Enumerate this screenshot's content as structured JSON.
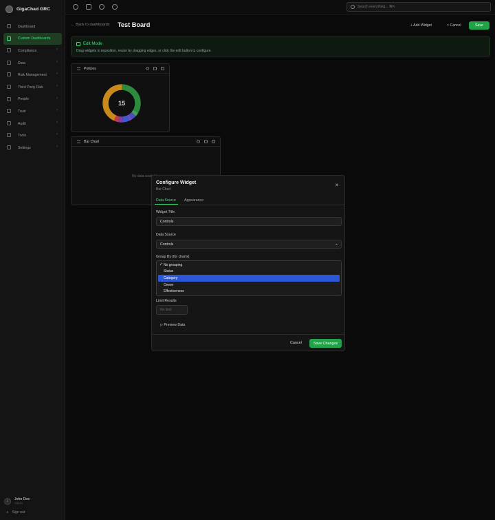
{
  "app": {
    "name": "GigaChad GRC"
  },
  "sidebar": {
    "items": [
      {
        "label": "Dashboard",
        "chevron": false,
        "active": false
      },
      {
        "label": "Custom Dashboards",
        "chevron": false,
        "active": true
      },
      {
        "label": "Compliance",
        "chevron": true,
        "active": false
      },
      {
        "label": "Data",
        "chevron": true,
        "active": false
      },
      {
        "label": "Risk Management",
        "chevron": true,
        "active": false
      },
      {
        "label": "Third Party Risk",
        "chevron": true,
        "active": false
      },
      {
        "label": "People",
        "chevron": true,
        "active": false
      },
      {
        "label": "Trust",
        "chevron": true,
        "active": false
      },
      {
        "label": "Audit",
        "chevron": true,
        "active": false
      },
      {
        "label": "Tools",
        "chevron": true,
        "active": false
      },
      {
        "label": "Settings",
        "chevron": true,
        "active": false
      }
    ],
    "user": {
      "initial": "J",
      "name": "John Doe",
      "role": "Admin"
    },
    "signout": "Sign out"
  },
  "topbar": {
    "search_placeholder": "Search everything...  ⌘K"
  },
  "header": {
    "back": "← Back to dashboards",
    "title": "Test Board",
    "add_widget": "+ Add Widget",
    "cancel": "× Cancel",
    "save": "Save"
  },
  "editmode": {
    "title": "Edit Mode",
    "text": "Drag widgets to reposition, resize by dragging edges, or click the edit button to configure."
  },
  "widgets": {
    "policies": {
      "title": "Policies",
      "total": "15",
      "segments": [
        {
          "value": 5,
          "color": "#2e8b3e"
        },
        {
          "value": 0.5,
          "color": "#3fa05a"
        },
        {
          "value": 0.6,
          "color": "#4b4fb5"
        },
        {
          "value": 0.4,
          "color": "#6b4fc8"
        },
        {
          "value": 0.8,
          "color": "#3b5bd0"
        },
        {
          "value": 0.6,
          "color": "#7a3fb0"
        },
        {
          "value": 0.6,
          "color": "#c23a4a"
        },
        {
          "value": 6.5,
          "color": "#c98a1c"
        }
      ]
    },
    "barchart": {
      "title": "Bar Chart",
      "empty": "No data available"
    }
  },
  "modal": {
    "title": "Configure Widget",
    "subtitle": "Bar Chart",
    "tabs": [
      "Data Source",
      "Appearance"
    ],
    "widget_title_label": "Widget Title",
    "widget_title_value": "Controls",
    "data_source_label": "Data Source",
    "data_source_value": "Controls",
    "group_by_label": "Group By (for charts)",
    "group_by_options": [
      "No grouping",
      "Status",
      "Category",
      "Owner",
      "Effectiveness"
    ],
    "group_by_checked": "No grouping",
    "group_by_highlighted": "Category",
    "limit_label": "Limit Results",
    "limit_placeholder": "No limit",
    "preview": "▷ Preview Data",
    "cancel": "Cancel",
    "save": "Save Changes"
  }
}
